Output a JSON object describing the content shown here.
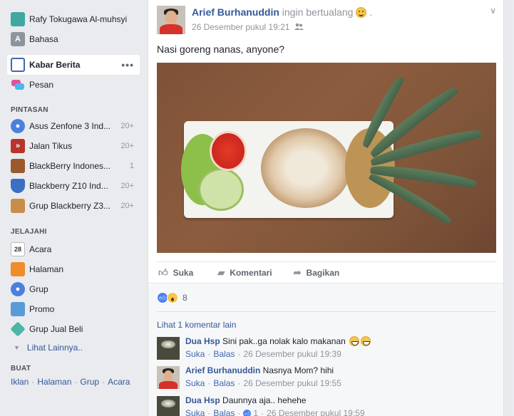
{
  "sidebar": {
    "profile": {
      "name": "Rafy Tokugawa Al-muhsyi"
    },
    "language": {
      "label": "Bahasa"
    },
    "news_feed": {
      "label": "Kabar Berita",
      "more": "•••"
    },
    "messages": {
      "label": "Pesan"
    },
    "shortcuts_heading": "PINTASAN",
    "shortcuts": [
      {
        "label": "Asus Zenfone 3 Ind...",
        "count": "20+"
      },
      {
        "label": "Jalan Tikus",
        "count": "20+"
      },
      {
        "label": "BlackBerry Indones...",
        "count": "1"
      },
      {
        "label": "Blackberry Z10 Ind...",
        "count": "20+"
      },
      {
        "label": "Grup Blackberry Z3...",
        "count": "20+"
      }
    ],
    "explore_heading": "JELAJAHI",
    "explore": [
      {
        "label": "Acara",
        "icon_text": "28"
      },
      {
        "label": "Halaman"
      },
      {
        "label": "Grup"
      },
      {
        "label": "Promo"
      },
      {
        "label": "Grup Jual Beli"
      }
    ],
    "see_more": "Lihat Lainnya..",
    "create_heading": "BUAT",
    "create_links": [
      "Iklan",
      "Halaman",
      "Grup",
      "Acara"
    ],
    "create_sep": "·"
  },
  "post": {
    "author": "Arief Burhanuddin",
    "activity": "ingin bertualang",
    "timestamp": "26 Desember pukul 19:21",
    "text": "Nasi goreng nanas, anyone?",
    "actions": {
      "like": "Suka",
      "comment": "Komentari",
      "share": "Bagikan"
    },
    "reaction_count": "8",
    "view_more_comments": "Lihat 1 komentar lain"
  },
  "comments": [
    {
      "author": "Dua Hsp",
      "text": "Sini pak..ga nolak kalo makanan",
      "like": "Suka",
      "reply": "Balas",
      "time": "26 Desember pukul 19:39",
      "likes": ""
    },
    {
      "author": "Arief Burhanuddin",
      "text": "Nasnya Mom? hihi",
      "like": "Suka",
      "reply": "Balas",
      "time": "26 Desember pukul 19:55",
      "likes": ""
    },
    {
      "author": "Dua Hsp",
      "text": "Daunnya aja.. hehehe",
      "like": "Suka",
      "reply": "Balas",
      "time": "26 Desember pukul 19:59",
      "likes": "1"
    }
  ],
  "comment_sep": "·",
  "colors": {
    "link": "#365899",
    "muted": "#90949c",
    "like_blue": "#4c7ef5",
    "bg": "#e9ebee"
  }
}
